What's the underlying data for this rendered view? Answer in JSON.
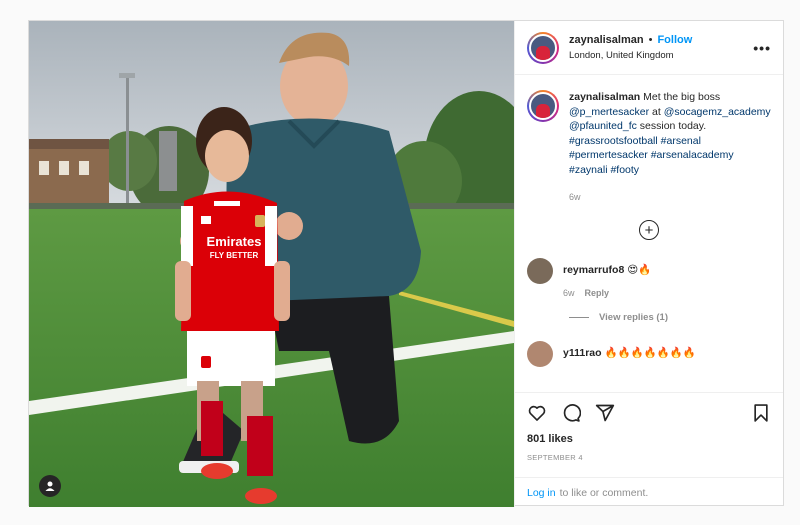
{
  "post": {
    "author": {
      "username": "zaynalisalman",
      "separator": "•",
      "follow_label": "Follow",
      "location": "London, United Kingdom"
    },
    "more_label": "•••",
    "caption": {
      "username": "zaynalisalman",
      "text_parts": [
        "Met the big boss",
        "@p_mertesacker",
        "at",
        "@socagemz_academy",
        "@pfaunited_fc",
        "session today.",
        "#grassrootsfootball",
        "#arsenal",
        "#permertesacker",
        "#arsenalacademy",
        "#zaynali",
        "#footy"
      ],
      "time": "6w"
    },
    "load_more_symbol": "+",
    "comments": [
      {
        "username": "reymarrufo8",
        "text": "😍🔥",
        "time": "6w",
        "reply_label": "Reply",
        "view_replies_label": "View replies (1)"
      },
      {
        "username": "y111rao",
        "text": "🔥🔥🔥🔥🔥🔥🔥"
      }
    ],
    "likes": "801 likes",
    "date": "SEPTEMBER 4",
    "login": {
      "link_label": "Log in",
      "suffix": "to like or comment."
    }
  },
  "photo": {
    "shirt_sponsor_line1": "Emirates",
    "shirt_sponsor_line2": "FLY BETTER"
  },
  "colors": {
    "follow": "#0095f6",
    "tag_link": "#00376b",
    "arsenal_red": "#db0007",
    "pitch_green": "#4f8f3a"
  },
  "icons": [
    "user-tag-icon",
    "more-options-icon",
    "load-more-icon",
    "heart-icon",
    "comment-icon",
    "share-icon",
    "bookmark-icon"
  ]
}
